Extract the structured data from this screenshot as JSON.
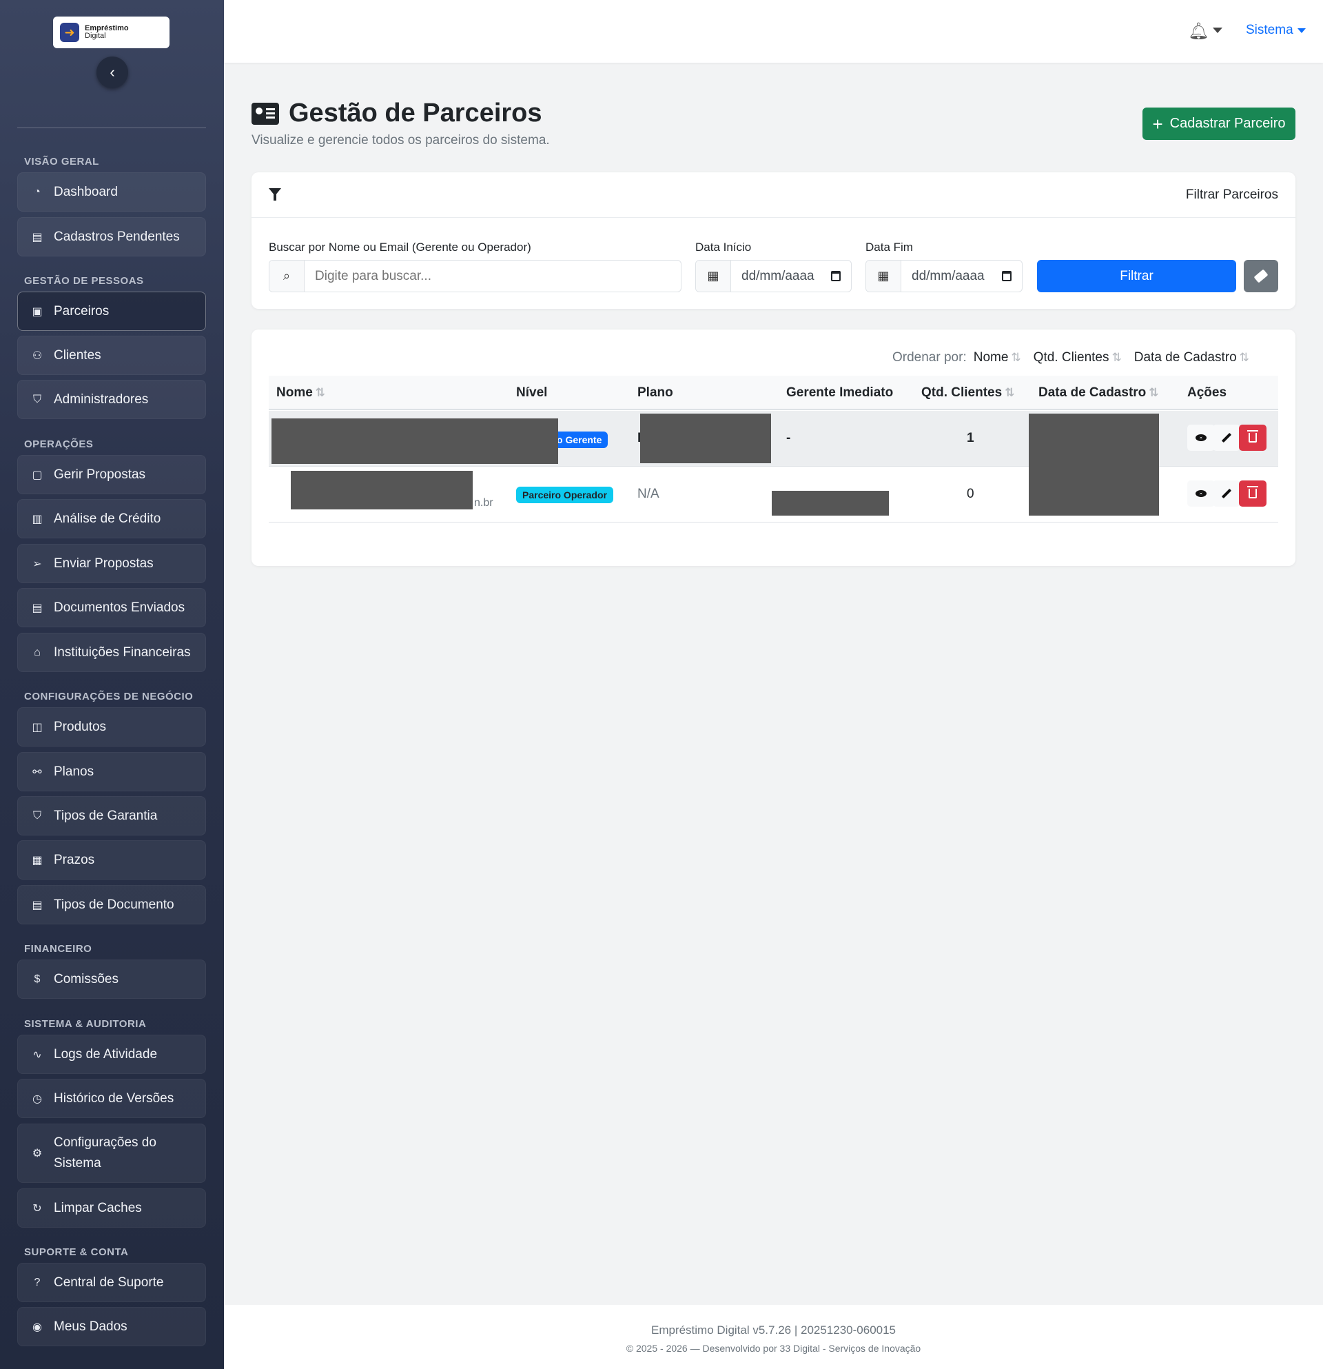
{
  "brand": {
    "line1": "Empréstimo",
    "line2": "Digital"
  },
  "sidebar": {
    "sections": [
      {
        "title": "VISÃO GERAL",
        "items": [
          {
            "label": "Dashboard",
            "icon": "gauge-icon"
          },
          {
            "label": "Cadastros Pendentes",
            "icon": "pending-doc-icon"
          }
        ]
      },
      {
        "title": "GESTÃO DE PESSOAS",
        "items": [
          {
            "label": "Parceiros",
            "icon": "id-card-icon",
            "active": true
          },
          {
            "label": "Clientes",
            "icon": "people-icon"
          },
          {
            "label": "Administradores",
            "icon": "shield-icon"
          }
        ]
      },
      {
        "title": "OPERAÇÕES",
        "items": [
          {
            "label": "Gerir Propostas",
            "icon": "clipboard-icon"
          },
          {
            "label": "Análise de Crédito",
            "icon": "clipboard-data-icon"
          },
          {
            "label": "Enviar Propostas",
            "icon": "send-icon"
          },
          {
            "label": "Documentos Enviados",
            "icon": "document-icon"
          },
          {
            "label": "Instituições Financeiras",
            "icon": "bank-icon"
          }
        ]
      },
      {
        "title": "CONFIGURAÇÕES DE NEGÓCIO",
        "items": [
          {
            "label": "Produtos",
            "icon": "box-icon"
          },
          {
            "label": "Planos",
            "icon": "diagram-icon"
          },
          {
            "label": "Tipos de Garantia",
            "icon": "shield-check-icon"
          },
          {
            "label": "Prazos",
            "icon": "calendar-icon"
          },
          {
            "label": "Tipos de Documento",
            "icon": "file-text-icon"
          }
        ]
      },
      {
        "title": "FINANCEIRO",
        "items": [
          {
            "label": "Comissões",
            "icon": "dollar-icon"
          }
        ]
      },
      {
        "title": "SISTEMA & AUDITORIA",
        "items": [
          {
            "label": "Logs de Atividade",
            "icon": "activity-icon"
          },
          {
            "label": "Histórico de Versões",
            "icon": "clock-history-icon"
          },
          {
            "label": "Configurações do Sistema",
            "icon": "gear-icon"
          },
          {
            "label": "Limpar Caches",
            "icon": "refresh-icon"
          }
        ]
      },
      {
        "title": "SUPORTE & CONTA",
        "items": [
          {
            "label": "Central de Suporte",
            "icon": "question-circle-icon"
          },
          {
            "label": "Meus Dados",
            "icon": "user-circle-icon"
          }
        ]
      }
    ]
  },
  "topbar": {
    "user_menu": "Sistema"
  },
  "header": {
    "title": "Gestão de Parceiros",
    "subtitle": "Visualize e gerencie todos os parceiros do sistema.",
    "add_button": "Cadastrar Parceiro"
  },
  "filters": {
    "title": "Filtrar Parceiros",
    "search_label": "Buscar por Nome ou Email (Gerente ou Operador)",
    "search_placeholder": "Digite para buscar...",
    "start_label": "Data Início",
    "end_label": "Data Fim",
    "date_placeholder": "dd/mm/aaaa",
    "filter_button": "Filtrar"
  },
  "table": {
    "order_label": "Ordenar por:",
    "order_options": [
      "Nome",
      "Qtd. Clientes",
      "Data de Cadastro"
    ],
    "columns": [
      "Nome",
      "Nível",
      "Plano",
      "Gerente Imediato",
      "Qtd. Clientes",
      "Data de Cadastro",
      "Ações"
    ],
    "rows": [
      {
        "nivel": "Parceiro Gerente",
        "nivel_visible": "o Gerente",
        "plano_fragment": "I",
        "gerente": "-",
        "clientes": "1"
      },
      {
        "email_fragment": "n.br",
        "nivel": "Parceiro Operador",
        "plano": "N/A",
        "clientes": "0"
      }
    ]
  },
  "footer": {
    "line1": "Empréstimo Digital v5.7.26 | 20251230-060015",
    "line2": "© 2025 - 2026 — Desenvolvido por 33 Digital - Serviços de Inovação"
  },
  "colors": {
    "primary": "#0d6efd",
    "success": "#198754",
    "danger": "#dc3545",
    "info": "#0dcaf0",
    "sidebar": "#2a324a"
  }
}
